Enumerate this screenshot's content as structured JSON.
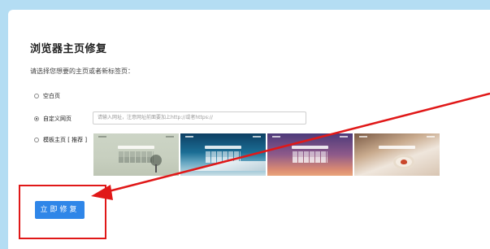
{
  "page": {
    "title": "浏览器主页修复",
    "subtitle": "请选择您想要的主页或者新标签页："
  },
  "options": [
    {
      "label": "空白页",
      "checked": false
    },
    {
      "label": "自定义网页",
      "checked": true
    },
    {
      "label": "模板主页 [ 推荐 ]",
      "checked": false
    }
  ],
  "url_input": {
    "placeholder": "请输入网址，注意网址前面要加上http://或者https://"
  },
  "thumbnails": [
    {
      "name": "template-green-tree"
    },
    {
      "name": "template-blue-mountain"
    },
    {
      "name": "template-purple-sunset"
    },
    {
      "name": "template-coffee"
    }
  ],
  "fix_button": {
    "label": "立即修复"
  },
  "colors": {
    "background": "#b4ddf3",
    "button": "#2f86e8",
    "annotation": "#e01818"
  }
}
